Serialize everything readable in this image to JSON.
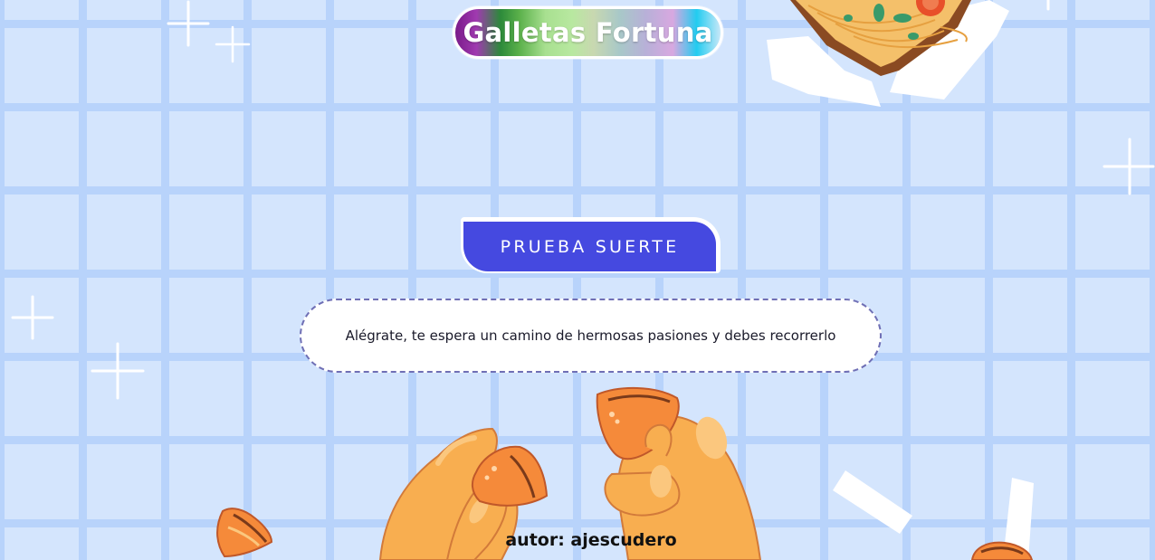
{
  "header": {
    "title": "Galletas Fortuna"
  },
  "main": {
    "button_label": "Prueba suerte",
    "fortune_message": "Alégrate, te espera un camino de hermosas pasiones y debes recorrerlo"
  },
  "footer": {
    "author": "autor: ajescudero"
  },
  "decorations": {
    "icons": [
      "sparkle-icon",
      "noodle-box-icon",
      "fortune-cookie-icon",
      "hands-icon",
      "paper-slip-icon"
    ]
  },
  "colors": {
    "background": "#d4e5fd",
    "grid": "#b8d3fb",
    "button": "#4549e0",
    "message_border": "#6f6fb5",
    "cookie": "#f58a3a",
    "hand": "#f8ae50"
  }
}
